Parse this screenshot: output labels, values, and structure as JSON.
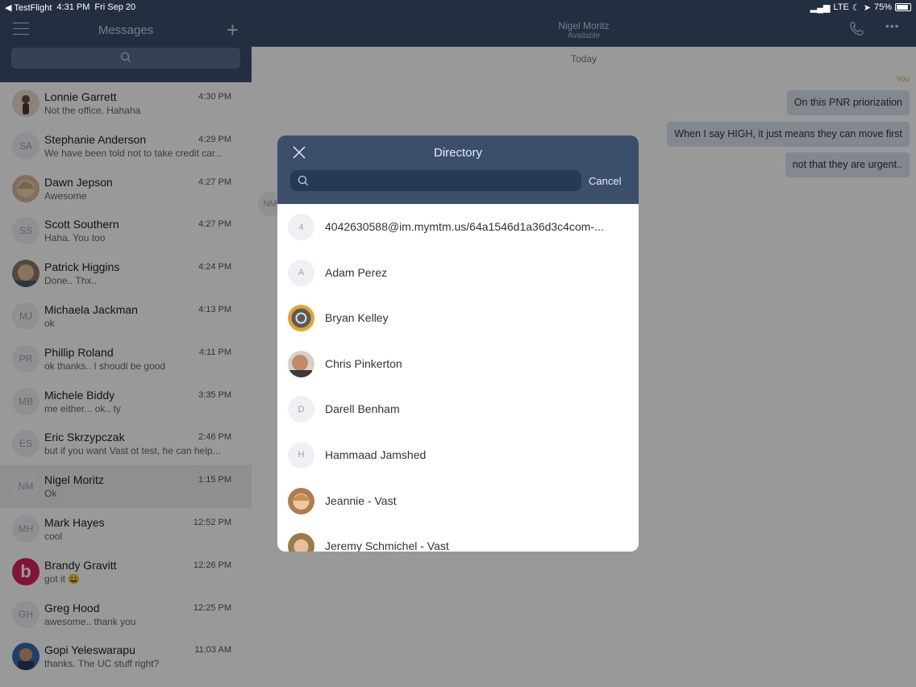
{
  "status_bar": {
    "app": "TestFlight",
    "time": "4:31 PM",
    "date": "Fri Sep 20",
    "network": "LTE",
    "battery": "75%"
  },
  "sidebar": {
    "title": "Messages",
    "conversations": [
      {
        "name": "Lonnie Garrett",
        "time": "4:30 PM",
        "preview": "Not the office. Hahaha",
        "initials": ""
      },
      {
        "name": "Stephanie Anderson",
        "time": "4:29 PM",
        "preview": "We have been told not to take credit car...",
        "initials": "SA"
      },
      {
        "name": "Dawn Jepson",
        "time": "4:27 PM",
        "preview": "Awesome",
        "initials": ""
      },
      {
        "name": "Scott Southern",
        "time": "4:27 PM",
        "preview": "Haha. You too",
        "initials": "SS"
      },
      {
        "name": "Patrick Higgins",
        "time": "4:24 PM",
        "preview": "Done..  Thx..",
        "initials": ""
      },
      {
        "name": "Michaela Jackman",
        "time": "4:13 PM",
        "preview": "ok",
        "initials": "MJ"
      },
      {
        "name": "Phillip Roland",
        "time": "4:11 PM",
        "preview": "ok thanks.. I shoudl be good",
        "initials": "PR"
      },
      {
        "name": "Michele Biddy",
        "time": "3:35 PM",
        "preview": "me either... ok.. ty",
        "initials": "MB"
      },
      {
        "name": "Eric Skrzypczak",
        "time": "2:46 PM",
        "preview": "but if you want Vast ot test, he can help...",
        "initials": "ES"
      },
      {
        "name": "Nigel Moritz",
        "time": "1:15 PM",
        "preview": "Ok",
        "initials": "NM"
      },
      {
        "name": "Mark Hayes",
        "time": "12:52 PM",
        "preview": "cool",
        "initials": "MH"
      },
      {
        "name": "Brandy Gravitt",
        "time": "12:26 PM",
        "preview": "got it 😀",
        "initials": "b"
      },
      {
        "name": "Greg Hood",
        "time": "12:25 PM",
        "preview": "awesome.. thank you",
        "initials": "GH"
      },
      {
        "name": "Gopi Yeleswarapu",
        "time": "11:03 AM",
        "preview": "thanks. The UC stuff right?",
        "initials": ""
      }
    ]
  },
  "chat": {
    "contact_name": "Nigel Moritz",
    "contact_status": "Available",
    "date_divider": "Today",
    "sender_label": "You",
    "messages": [
      "On this PNR priorization",
      "When I say HIGH, it just means they can move first",
      "not that they are urgent.."
    ],
    "partner_initials": "NM"
  },
  "directory": {
    "title": "Directory",
    "search_placeholder": "",
    "cancel_label": "Cancel",
    "contacts": [
      {
        "name": "4042630588@im.mymtm.us/64a1546d1a36d3c4com-...",
        "initial": "4",
        "photo": false
      },
      {
        "name": "Adam Perez",
        "initial": "A",
        "photo": false
      },
      {
        "name": "Bryan Kelley",
        "initial": "",
        "photo": true
      },
      {
        "name": "Chris Pinkerton",
        "initial": "",
        "photo": true
      },
      {
        "name": "Darell Benham",
        "initial": "D",
        "photo": false
      },
      {
        "name": "Hammaad Jamshed",
        "initial": "H",
        "photo": false
      },
      {
        "name": "Jeannie - Vast",
        "initial": "",
        "photo": true
      },
      {
        "name": "Jeremy Schmichel - Vast",
        "initial": "",
        "photo": true
      }
    ]
  },
  "colors": {
    "header": "#3b4f6b",
    "bubble": "#d9e3f0",
    "sender_label": "#d4b43a"
  }
}
